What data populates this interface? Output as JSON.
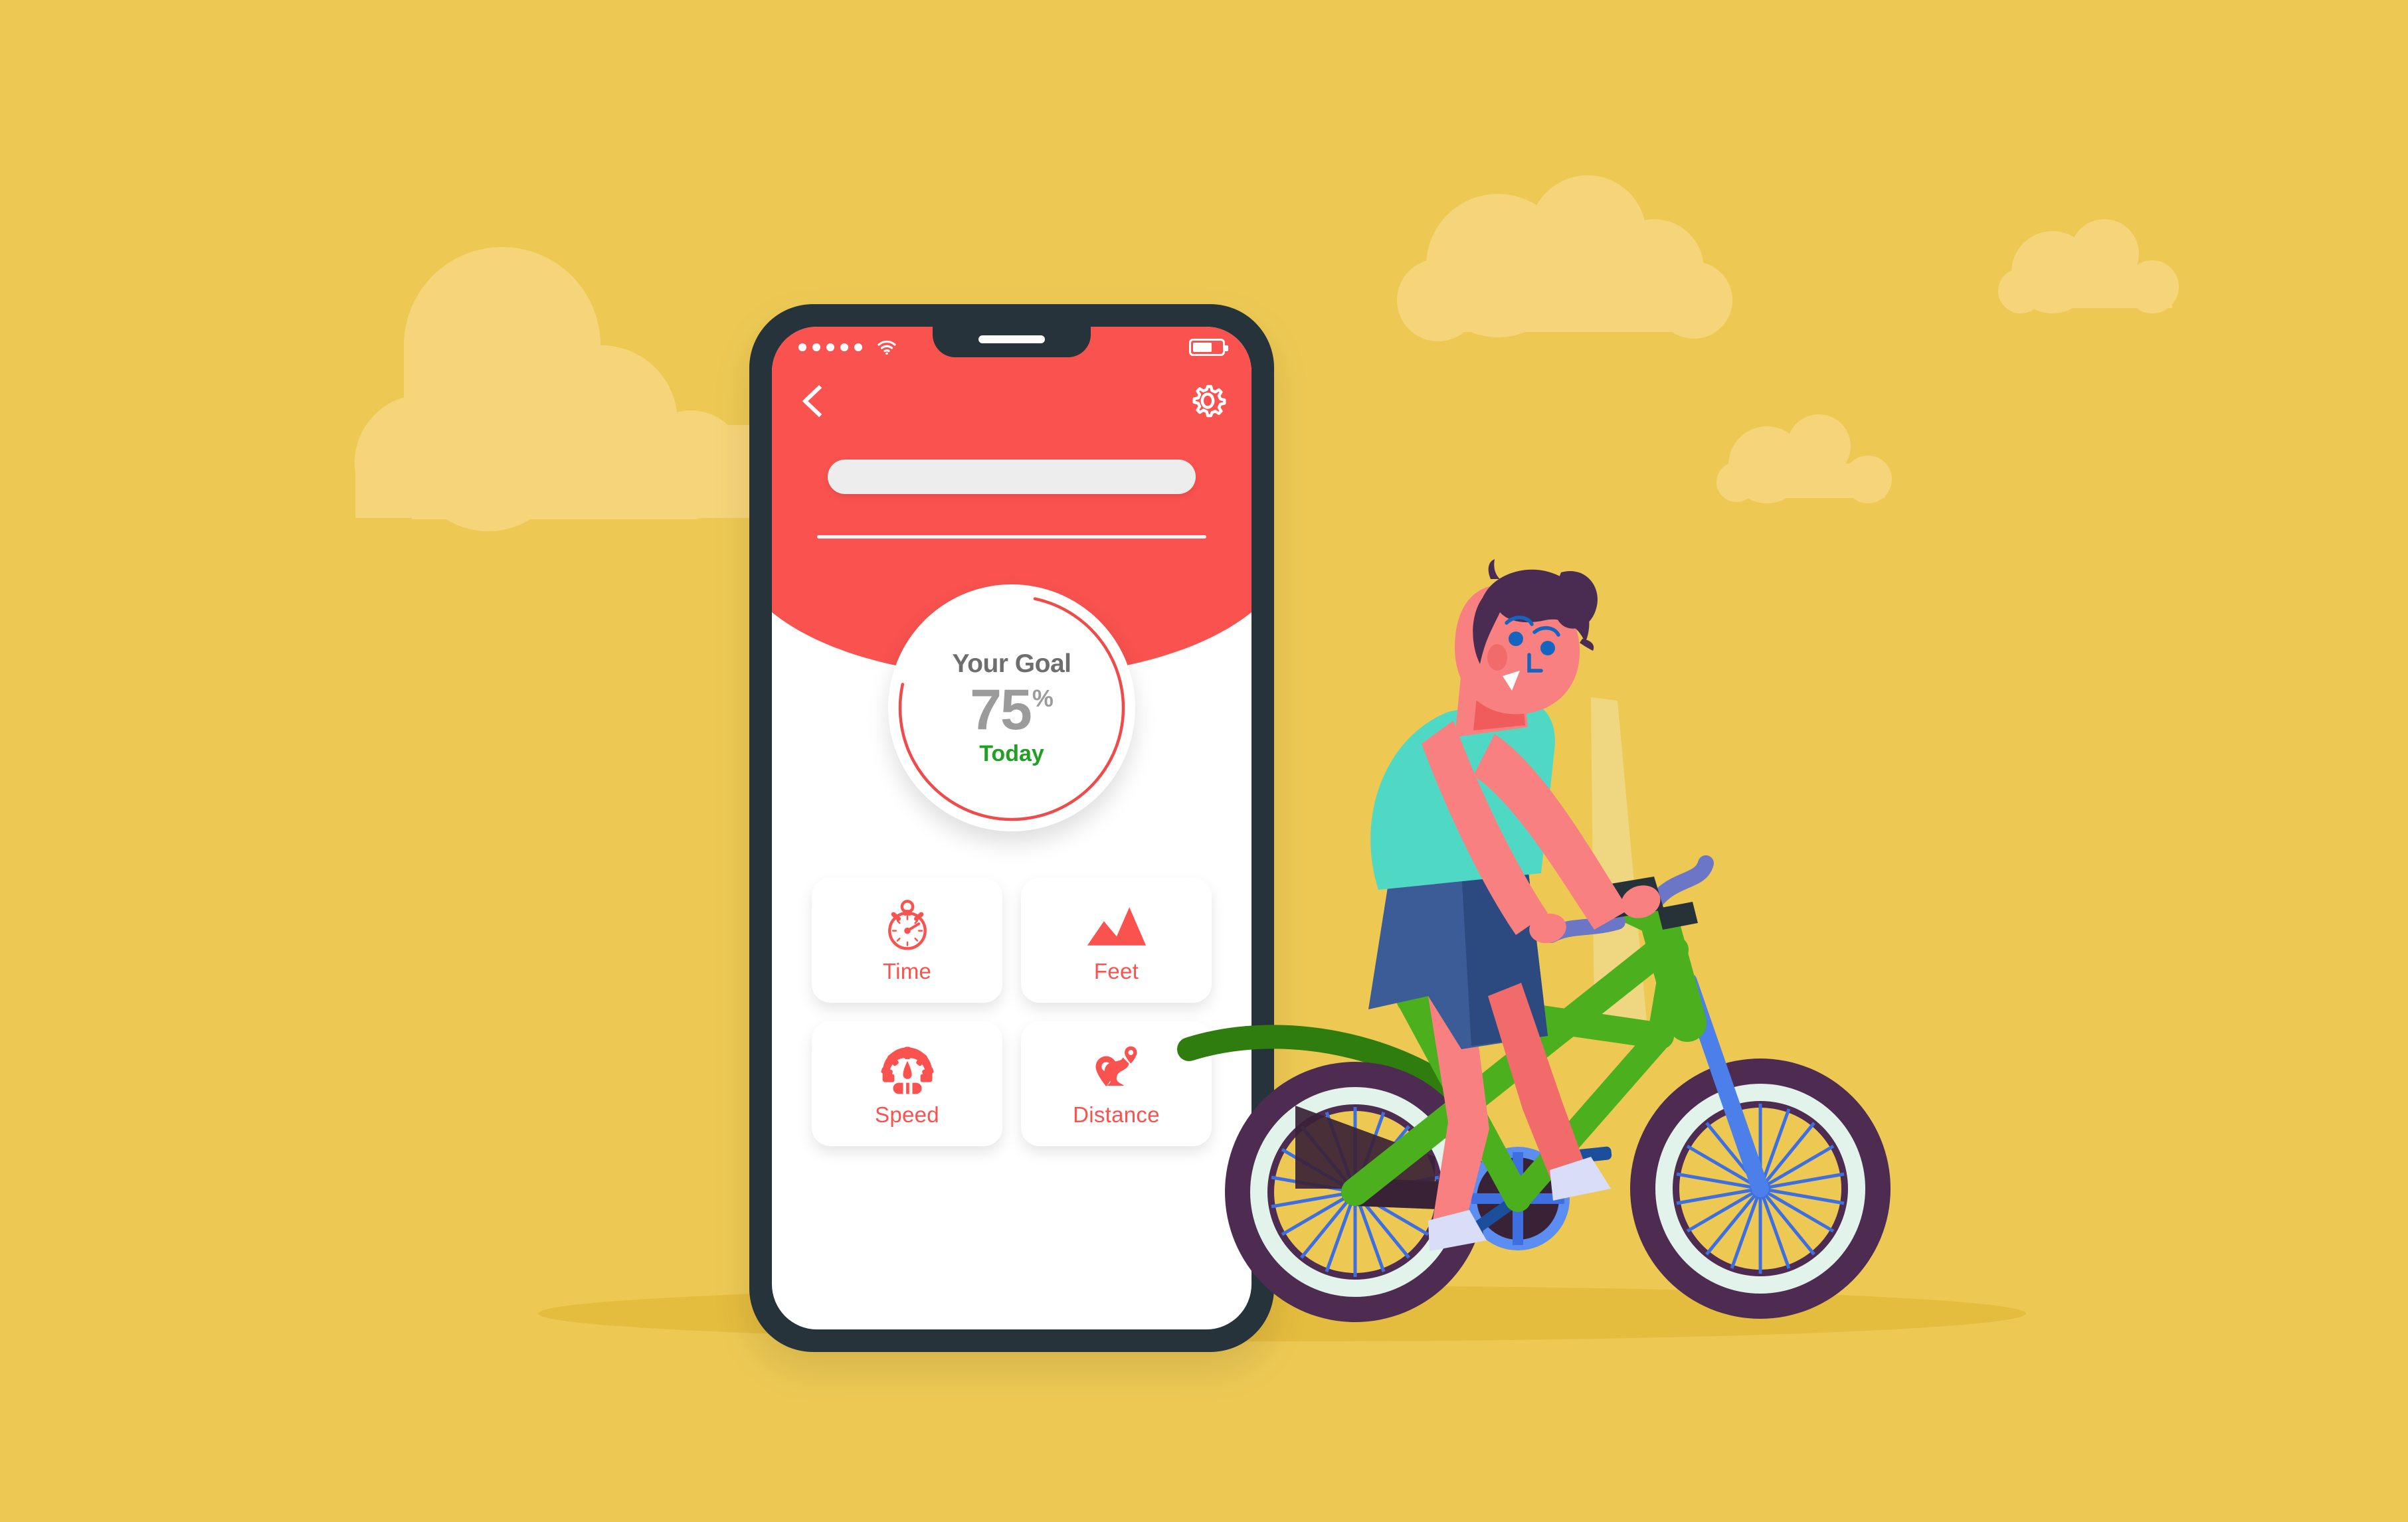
{
  "scene": {
    "background_color": "#EDC954",
    "cloud_color": "#F6D479",
    "ground_shadow_color": "#E4BC3E",
    "title": "Fitness tracking app illustration"
  },
  "phone": {
    "frame_color": "#26333B",
    "screen_color": "#FFFFFF",
    "header_color": "#F9524F"
  },
  "statusbar": {
    "signal_dots": 5,
    "wifi_icon": "wifi-icon",
    "battery_icon": "battery-icon",
    "battery_level_pct": 58
  },
  "nav": {
    "back_icon": "chevron-left-icon",
    "settings_icon": "gear-icon"
  },
  "search": {
    "value": "",
    "placeholder": ""
  },
  "goal": {
    "label": "Your Goal",
    "value": "75",
    "unit": "%",
    "period": "Today",
    "progress_pct": 75,
    "ring_color": "#EF4B4B",
    "label_color": "#6E6E6E",
    "value_color": "#9B9B9B",
    "period_color": "#22A023"
  },
  "cards": [
    {
      "id": "time",
      "label": "Time",
      "icon": "stopwatch-icon"
    },
    {
      "id": "feet",
      "label": "Feet",
      "icon": "mountains-icon"
    },
    {
      "id": "speed",
      "label": "Speed",
      "icon": "speedometer-icon"
    },
    {
      "id": "distance",
      "label": "Distance",
      "icon": "route-pin-icon"
    }
  ],
  "card_accent_color": "#F9524F",
  "illustration": {
    "name": "man-riding-bicycle",
    "rider": {
      "hair_color": "#4A2B52",
      "skin_color": "#F98080",
      "shirt_color": "#4FD9C4",
      "shorts_color": "#3B5C96",
      "shoe_color": "#D9DDF7",
      "eye_color": "#1565C0"
    },
    "bicycle": {
      "frame_color": "#4CAF1E",
      "frame_dark_color": "#2E7D0E",
      "tire_color": "#4E2B50",
      "rim_color": "#E2F3EC",
      "spoke_color": "#3D6FE0",
      "fork_color": "#4D7FEA",
      "seat_color": "#F57C0F",
      "crank_color": "#4D7FEA",
      "pedal_color": "#1B4F9C",
      "handlebar_color": "#6B76C6",
      "spokes_per_wheel": 18
    }
  }
}
